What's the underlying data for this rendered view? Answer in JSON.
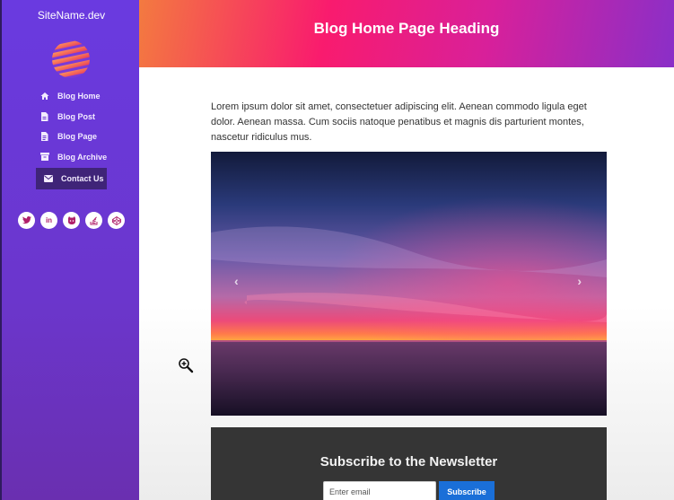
{
  "sidebar": {
    "site_name": "SiteName.dev",
    "items": [
      {
        "label": "Blog Home",
        "icon": "home-icon"
      },
      {
        "label": "Blog Post",
        "icon": "file-icon"
      },
      {
        "label": "Blog Page",
        "icon": "file-text-icon"
      },
      {
        "label": "Blog Archive",
        "icon": "archive-icon"
      },
      {
        "label": "Contact Us",
        "icon": "envelope-icon",
        "active": true
      }
    ],
    "socials": [
      "twitter-icon",
      "linkedin-icon",
      "github-icon",
      "stackoverflow-icon",
      "codepen-icon"
    ]
  },
  "header": {
    "title": "Blog Home Page Heading"
  },
  "main": {
    "intro": "Lorem ipsum dolor sit amet, consectetuer adipiscing elit. Aenean commodo ligula eget dolor. Aenean massa. Cum sociis natoque penatibus et magnis dis parturient montes, nascetur ridiculus mus.",
    "carousel": {
      "prev": "‹",
      "next": "›"
    },
    "newsletter": {
      "title": "Subscribe to the Newsletter",
      "email_placeholder": "Enter email",
      "button": "Subscribe"
    }
  },
  "colors": {
    "sidebar": "#6b36cc",
    "active_item": "#3f2478",
    "header_start": "#f37a40",
    "header_end": "#8a2fc8",
    "subscribe_button": "#1a6fd8",
    "newsletter_bg": "#353535"
  }
}
